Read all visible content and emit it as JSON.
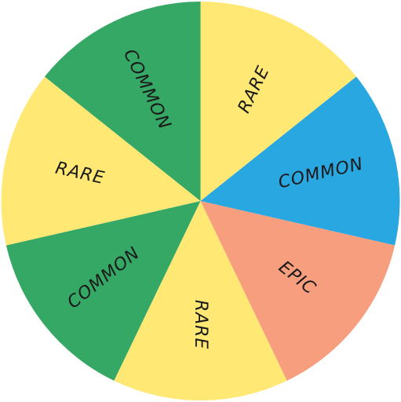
{
  "wheel": {
    "segments": [
      {
        "label": "RARE",
        "color": "#FFE873"
      },
      {
        "label": "COMMON",
        "color": "#29A7E1"
      },
      {
        "label": "EPIC",
        "color": "#F69E7E"
      },
      {
        "label": "RARE",
        "color": "#FFE873"
      },
      {
        "label": "COMMON",
        "color": "#36A865"
      },
      {
        "label": "RARE",
        "color": "#FFE873"
      },
      {
        "label": "COMMON",
        "color": "#36A865"
      }
    ]
  }
}
